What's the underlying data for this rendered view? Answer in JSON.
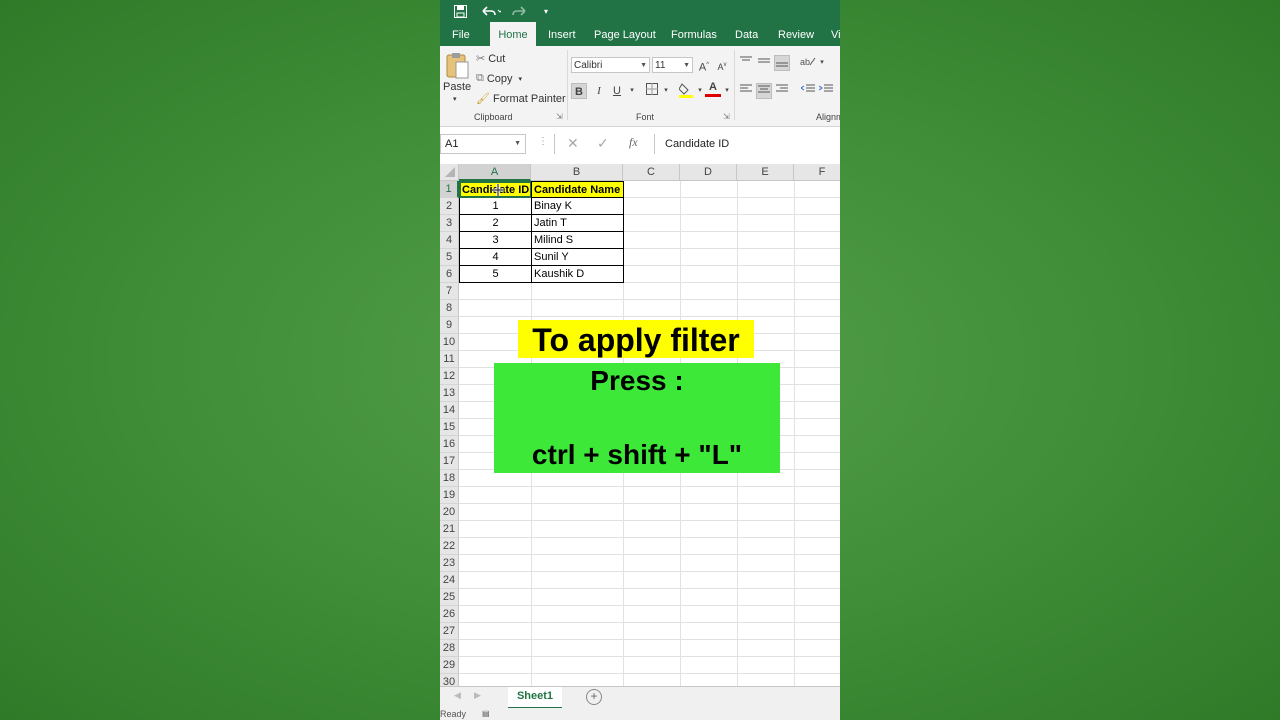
{
  "titlebar": {
    "save_icon": "save-icon",
    "undo_icon": "undo-icon",
    "redo_icon": "redo-icon",
    "customize_icon": "customize-quick-access-icon"
  },
  "tabs": [
    {
      "label": "File"
    },
    {
      "label": "Home"
    },
    {
      "label": "Insert"
    },
    {
      "label": "Page Layout"
    },
    {
      "label": "Formulas"
    },
    {
      "label": "Data"
    },
    {
      "label": "Review"
    },
    {
      "label": "Vi"
    }
  ],
  "ribbon": {
    "clipboard": {
      "paste": "Paste",
      "cut": "Cut",
      "copy": "Copy",
      "format_painter": "Format Painter",
      "label": "Clipboard"
    },
    "font": {
      "font_name": "Calibri",
      "font_size": "11",
      "label": "Font",
      "bold": "B",
      "italic": "I",
      "underline": "U",
      "grow": "A",
      "shrink": "A",
      "font_color": "A"
    },
    "alignment": {
      "label": "Alignm"
    }
  },
  "formula_bar": {
    "name_box": "A1",
    "fx": "fx",
    "content": "Candidate ID"
  },
  "columns": [
    "A",
    "B",
    "C",
    "D",
    "E",
    "F"
  ],
  "rows": [
    "1",
    "2",
    "3",
    "4",
    "5",
    "6",
    "7",
    "8",
    "9",
    "10",
    "11",
    "12",
    "13",
    "14",
    "15",
    "16",
    "17",
    "18",
    "19",
    "20",
    "21",
    "22",
    "23",
    "24",
    "25",
    "26",
    "27",
    "28",
    "29",
    "30"
  ],
  "table": {
    "headers": [
      "Candidate ID",
      "Candidate Name"
    ],
    "rows": [
      [
        "1",
        "Binay K"
      ],
      [
        "2",
        "Jatin T"
      ],
      [
        "3",
        "Milind S"
      ],
      [
        "4",
        "Sunil Y"
      ],
      [
        "5",
        "Kaushik D"
      ]
    ]
  },
  "overlay": {
    "title": "To apply filter",
    "press": "Press :",
    "keys": "ctrl + shift + \"L\""
  },
  "sheets": [
    {
      "label": "Sheet1"
    }
  ],
  "status": {
    "text": "Ready"
  },
  "colors": {
    "excel_green": "#217346",
    "header_fill": "#ffff00",
    "overlay_box": "#3de838"
  }
}
